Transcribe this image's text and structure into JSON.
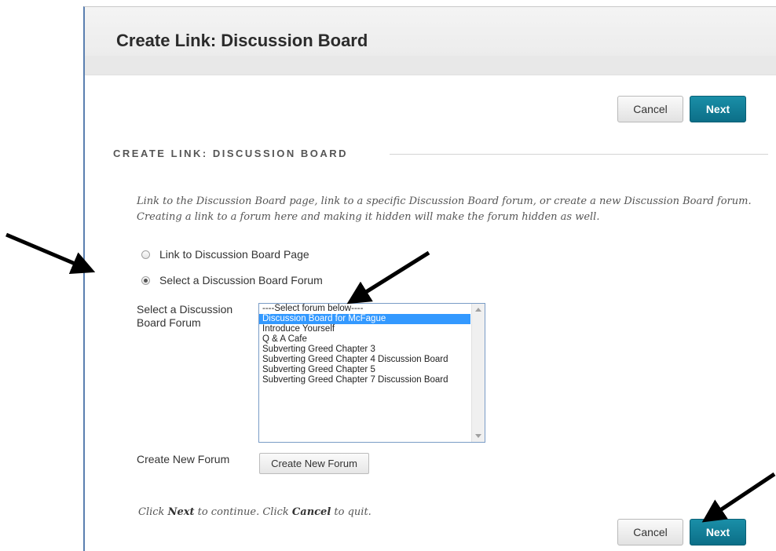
{
  "page": {
    "title": "Create Link: Discussion Board"
  },
  "buttons": {
    "cancel": "Cancel",
    "next": "Next",
    "create_new_forum": "Create New Forum"
  },
  "section": {
    "heading": "CREATE LINK: DISCUSSION BOARD",
    "instructions": "Link to the Discussion Board page, link to a specific Discussion Board forum, or create a new Discussion Board forum. Creating a link to a forum here and making it hidden will make the forum hidden as well."
  },
  "options": {
    "link_page": "Link to Discussion Board Page",
    "select_forum": "Select a Discussion Board Forum",
    "selected": "select_forum"
  },
  "fields": {
    "select_forum_label": "Select a Discussion Board Forum",
    "create_forum_label": "Create New Forum"
  },
  "forum_list": {
    "selected_index": 1,
    "items": [
      "----Select forum below----",
      "Discussion Board for McFague",
      "Introduce Yourself",
      "Q & A Cafe",
      "Subverting Greed Chapter 3",
      "Subverting Greed Chapter 4 Discussion Board",
      "Subverting Greed Chapter 5",
      "Subverting Greed Chapter 7 Discussion Board"
    ]
  },
  "footer": {
    "prefix": "Click ",
    "next": "Next",
    "middle": " to continue. Click ",
    "cancel": "Cancel",
    "suffix": " to quit."
  },
  "colors": {
    "accent": "#0c6f88",
    "selection": "#3399ff",
    "panel_border": "#5a7fb0"
  }
}
